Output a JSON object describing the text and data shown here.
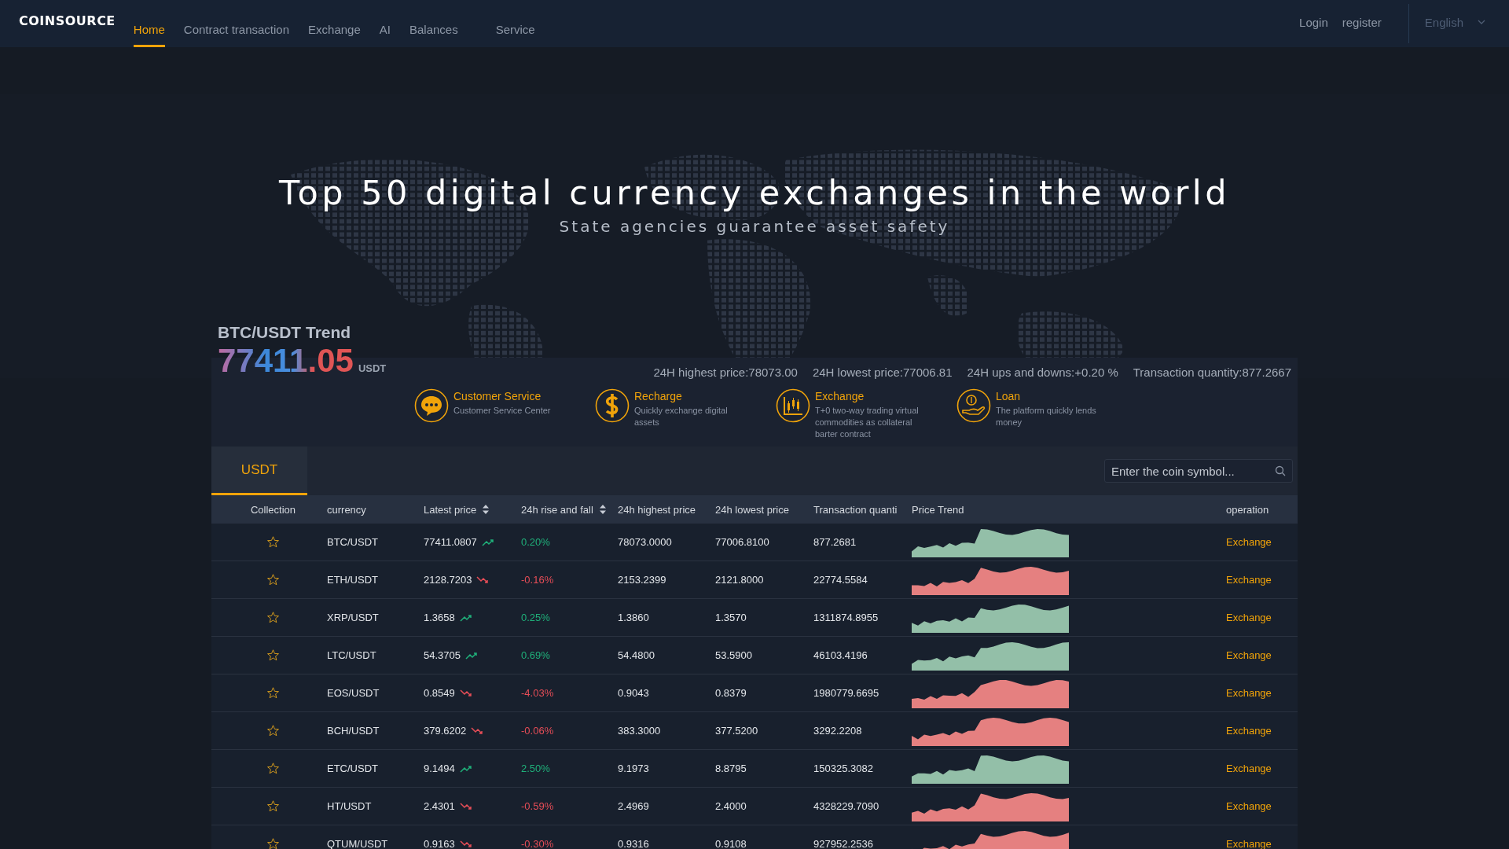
{
  "brand": {
    "logo": "COINSOURCE"
  },
  "nav": [
    {
      "label": "Home",
      "selected": true
    },
    {
      "label": "Contract transaction",
      "selected": false
    },
    {
      "label": "Exchange",
      "selected": false
    },
    {
      "label": "AI",
      "selected": false
    },
    {
      "label": "Balances",
      "selected": false
    },
    {
      "label": "Service",
      "selected": false
    }
  ],
  "account": {
    "login": "Login",
    "register": "register",
    "language": "English"
  },
  "hero": {
    "title": "Top 50 digital currency exchanges in the world",
    "subtitle": "State agencies guarantee asset safety"
  },
  "ticker": {
    "title": "BTC/USDT Trend",
    "price": "77411.05",
    "unit": "USDT",
    "stats": [
      "24H highest price:78073.00",
      "24H lowest price:77006.81",
      "24H ups and downs:+0.20 %",
      "Transaction quantity:877.2667"
    ]
  },
  "services": [
    {
      "kind": "chat",
      "title": "Customer Service",
      "text": "Customer Service Center"
    },
    {
      "kind": "dollar",
      "title": "Recharge",
      "text": "Quickly exchange digital assets"
    },
    {
      "kind": "candles",
      "title": "Exchange",
      "text": "T+0 two-way trading virtual commodities as collateral barter contract"
    },
    {
      "kind": "loan",
      "title": "Loan",
      "text": "The platform quickly lends money"
    }
  ],
  "market_tabs": [
    {
      "label": "USDT",
      "selected": true
    }
  ],
  "search": {
    "placeholder": "Enter the coin symbol..."
  },
  "table": {
    "columns": [
      {
        "label": "Collection",
        "sortable": false
      },
      {
        "label": "currency",
        "sortable": false
      },
      {
        "label": "Latest price",
        "sortable": true
      },
      {
        "label": "24h rise and fall",
        "sortable": true
      },
      {
        "label": "24h highest price",
        "sortable": false
      },
      {
        "label": "24h lowest price",
        "sortable": false
      },
      {
        "label": "Transaction quanti",
        "sortable": false
      },
      {
        "label": "Price Trend",
        "sortable": false
      },
      {
        "label": "operation",
        "sortable": false
      }
    ],
    "rows": [
      {
        "pair": "BTC/USDT",
        "price": "77411.0807",
        "rising": true,
        "change": "0.20%",
        "high": "78073.0000",
        "low": "77006.8100",
        "volume": "877.2681",
        "action": "Exchange"
      },
      {
        "pair": "ETH/USDT",
        "price": "2128.7203",
        "rising": false,
        "change": "-0.16%",
        "high": "2153.2399",
        "low": "2121.8000",
        "volume": "22774.5584",
        "action": "Exchange"
      },
      {
        "pair": "XRP/USDT",
        "price": "1.3658",
        "rising": true,
        "change": "0.25%",
        "high": "1.3860",
        "low": "1.3570",
        "volume": "1311874.8955",
        "action": "Exchange"
      },
      {
        "pair": "LTC/USDT",
        "price": "54.3705",
        "rising": true,
        "change": "0.69%",
        "high": "54.4800",
        "low": "53.5900",
        "volume": "46103.4196",
        "action": "Exchange"
      },
      {
        "pair": "EOS/USDT",
        "price": "0.8549",
        "rising": false,
        "change": "-4.03%",
        "high": "0.9043",
        "low": "0.8379",
        "volume": "1980779.6695",
        "action": "Exchange"
      },
      {
        "pair": "BCH/USDT",
        "price": "379.6202",
        "rising": false,
        "change": "-0.06%",
        "high": "383.3000",
        "low": "377.5200",
        "volume": "3292.2208",
        "action": "Exchange"
      },
      {
        "pair": "ETC/USDT",
        "price": "9.1494",
        "rising": true,
        "change": "2.50%",
        "high": "9.1973",
        "low": "8.8795",
        "volume": "150325.3082",
        "action": "Exchange"
      },
      {
        "pair": "HT/USDT",
        "price": "2.4301",
        "rising": false,
        "change": "-0.59%",
        "high": "2.4969",
        "low": "2.4000",
        "volume": "4328229.7090",
        "action": "Exchange"
      },
      {
        "pair": "QTUM/USDT",
        "price": "0.9163",
        "rising": false,
        "change": "-0.30%",
        "high": "0.9316",
        "low": "0.9108",
        "volume": "927952.2536",
        "action": "Exchange"
      }
    ]
  }
}
